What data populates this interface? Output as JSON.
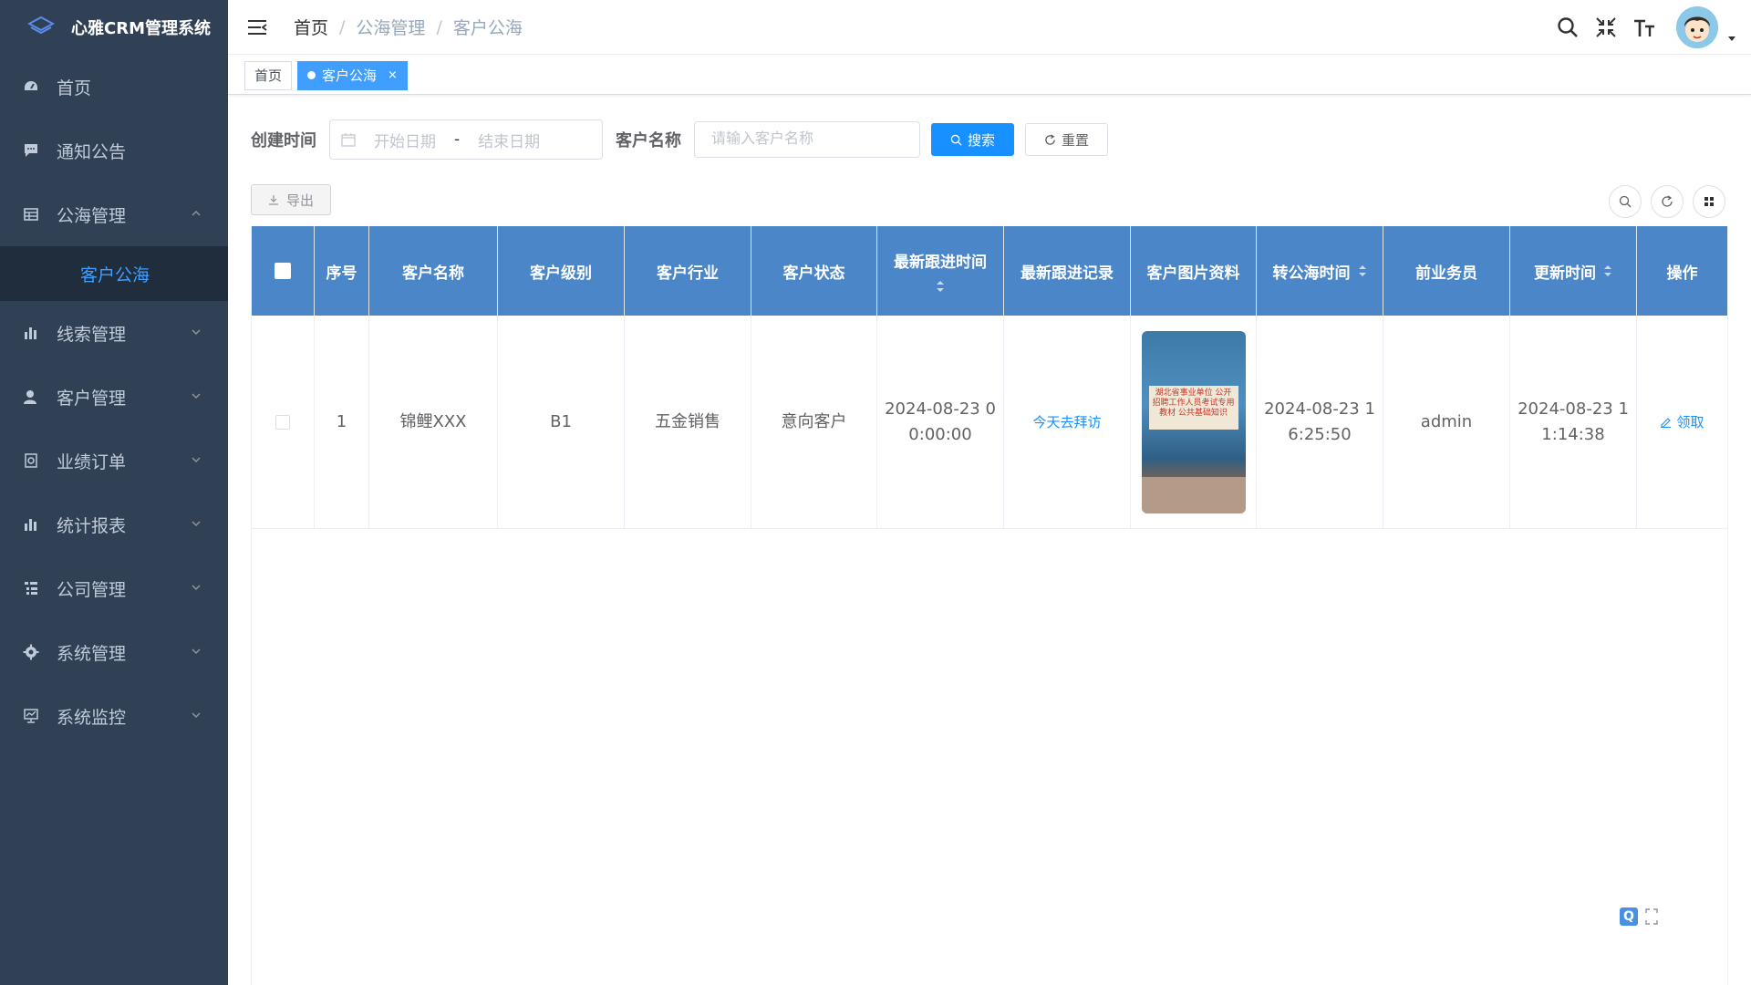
{
  "app": {
    "title": "心雅CRM管理系统"
  },
  "sidebar": {
    "items": [
      {
        "label": "首页",
        "icon": "dashboard-icon"
      },
      {
        "label": "通知公告",
        "icon": "message-icon"
      },
      {
        "label": "公海管理",
        "icon": "table-icon",
        "expanded": true,
        "children": [
          {
            "label": "客户公海",
            "active": true
          }
        ]
      },
      {
        "label": "线索管理",
        "icon": "chart-icon"
      },
      {
        "label": "客户管理",
        "icon": "user-icon"
      },
      {
        "label": "业绩订单",
        "icon": "order-icon"
      },
      {
        "label": "统计报表",
        "icon": "chart-icon"
      },
      {
        "label": "公司管理",
        "icon": "tree-table-icon"
      },
      {
        "label": "系统管理",
        "icon": "gear-icon"
      },
      {
        "label": "系统监控",
        "icon": "monitor-icon"
      }
    ]
  },
  "breadcrumb": [
    "首页",
    "公海管理",
    "客户公海"
  ],
  "tags": [
    {
      "label": "首页",
      "active": false
    },
    {
      "label": "客户公海",
      "active": true
    }
  ],
  "search": {
    "date_label": "创建时间",
    "start_placeholder": "开始日期",
    "range_sep": "-",
    "end_placeholder": "结束日期",
    "name_label": "客户名称",
    "name_placeholder": "请输入客户名称",
    "search_btn": "搜索",
    "reset_btn": "重置"
  },
  "toolbar": {
    "export_btn": "导出"
  },
  "table": {
    "headers": [
      "序号",
      "客户名称",
      "客户级别",
      "客户行业",
      "客户状态",
      "最新跟进时间",
      "最新跟进记录",
      "客户图片资料",
      "转公海时间",
      "前业务员",
      "更新时间",
      "操作"
    ],
    "rows": [
      {
        "index": "1",
        "name": "锦鲤XXX",
        "level": "B1",
        "industry": "五金销售",
        "status": "意向客户",
        "last_follow_time": "2024-08-23 00:00:00",
        "last_follow_record": "今天去拜访",
        "image_caption": "湖北省事业单位 公开招聘工作人员考试专用教材 公共基础知识",
        "to_sea_time": "2024-08-23 16:25:50",
        "prev_salesman": "admin",
        "update_time": "2024-08-23 11:14:38",
        "action": "领取"
      }
    ]
  },
  "colors": {
    "sidebar_bg": "#304156",
    "primary": "#1890ff",
    "table_header": "#4a86c8"
  }
}
